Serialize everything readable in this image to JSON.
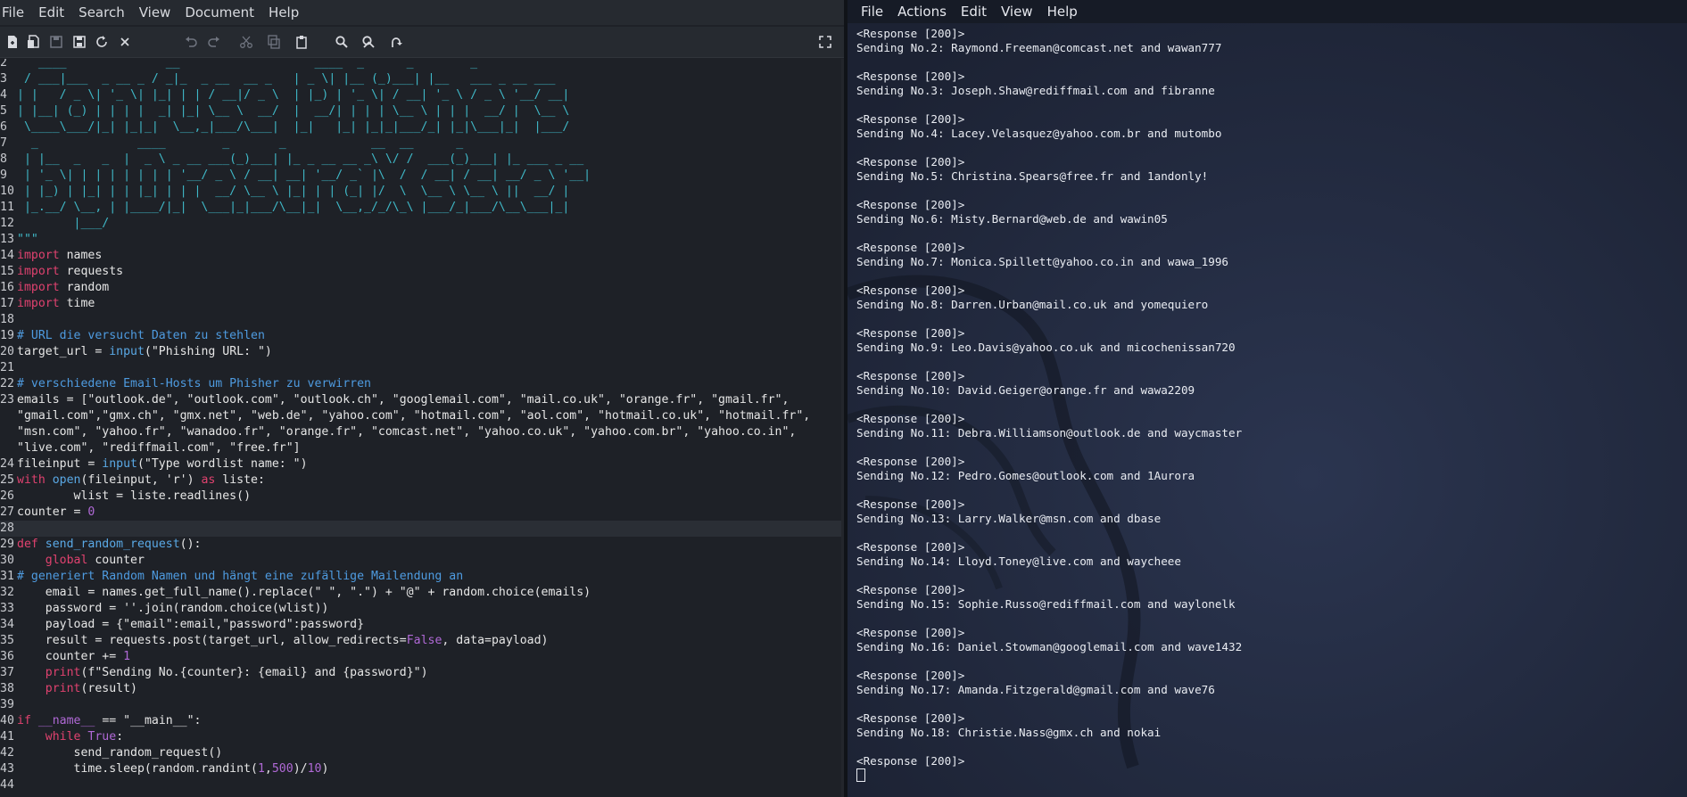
{
  "editor": {
    "menu": [
      "File",
      "Edit",
      "Search",
      "View",
      "Document",
      "Help"
    ],
    "toolbar_icons": [
      "new-file-icon",
      "new-window-icon",
      "save-icon",
      "save-as-icon",
      "reload-icon",
      "close-icon",
      "undo-icon",
      "redo-icon",
      "cut-icon",
      "copy-icon",
      "paste-icon",
      "find-icon",
      "find-replace-icon",
      "goto-icon",
      "fullscreen-icon"
    ],
    "current_line": 28,
    "lines": [
      {
        "n": "2",
        "segs": [
          [
            "art",
            "   ____              __                   ____  _      _        _        "
          ]
        ]
      },
      {
        "n": "3",
        "segs": [
          [
            "art",
            " / ___|___  _ __ _ / _|_  _ __  __ _   | _ \\| |__ (_)___| |__   ___ _ __ ___"
          ]
        ]
      },
      {
        "n": "4",
        "segs": [
          [
            "art",
            "| |   / _ \\| '_ \\| |_| | | / __|/ _ \\  | |_) | '_ \\| / __| '_ \\ / _ \\ '__/ __|"
          ]
        ]
      },
      {
        "n": "5",
        "segs": [
          [
            "art",
            "| |__| (_) | | | |  _| |_| \\__ \\  __/  |  __/| | | | \\__ \\ | | |  __/ |  \\__ \\"
          ]
        ]
      },
      {
        "n": "6",
        "segs": [
          [
            "art",
            " \\____\\___/|_| |_|_|  \\__,_|___/\\___|  |_|   |_| |_|_|___/_| |_|\\___|_|  |___/"
          ]
        ]
      },
      {
        "n": "7",
        "segs": [
          [
            "art",
            "  _              ____        _       _            __  __      _     "
          ]
        ]
      },
      {
        "n": "8",
        "segs": [
          [
            "art",
            " | |__  _   _  |  _ \\ _ __ ___(_)___| |_ _ __ __ _\\ \\/ /  ___(_)___| |_ ___ _ __"
          ]
        ]
      },
      {
        "n": "9",
        "segs": [
          [
            "art",
            " | '_ \\| | | | | | | | '__/ _ \\ / __| __| '__/ _` |\\  /  / __| / __| __/ _ \\ '__|"
          ]
        ]
      },
      {
        "n": "10",
        "segs": [
          [
            "art",
            " | |_) | |_| | | |_| | | |  __/ \\__ \\ |_| | | (_| |/  \\  \\__ \\ \\__ \\ ||  __/ |"
          ]
        ]
      },
      {
        "n": "11",
        "segs": [
          [
            "art",
            " |_.__/ \\__, | |____/|_|  \\___|_|___/\\__|_|  \\__,_/_/\\_\\ |___/_|___/\\__\\___|_|"
          ]
        ]
      },
      {
        "n": "12",
        "segs": [
          [
            "art",
            "        |___/"
          ]
        ]
      },
      {
        "n": "13",
        "segs": [
          [
            "art",
            "\"\"\""
          ]
        ]
      },
      {
        "n": "14",
        "segs": [
          [
            "kw",
            "import"
          ],
          [
            "",
            " names"
          ]
        ]
      },
      {
        "n": "15",
        "segs": [
          [
            "kw",
            "import"
          ],
          [
            "",
            " requests"
          ]
        ]
      },
      {
        "n": "16",
        "segs": [
          [
            "kw",
            "import"
          ],
          [
            "",
            " random"
          ]
        ]
      },
      {
        "n": "17",
        "segs": [
          [
            "kw",
            "import"
          ],
          [
            "",
            " time"
          ]
        ]
      },
      {
        "n": "18",
        "segs": [
          [
            "",
            ""
          ]
        ]
      },
      {
        "n": "19",
        "segs": [
          [
            "cm",
            "# URL die versucht Daten zu stehlen"
          ]
        ]
      },
      {
        "n": "20",
        "segs": [
          [
            "",
            "target_url = "
          ],
          [
            "bl",
            "input"
          ],
          [
            "",
            "(\"Phishing URL: \")"
          ]
        ]
      },
      {
        "n": "21",
        "segs": [
          [
            "",
            ""
          ]
        ]
      },
      {
        "n": "22",
        "segs": [
          [
            "cm",
            "# verschiedene Email-Hosts um Phisher zu verwirren"
          ]
        ]
      },
      {
        "n": "23",
        "segs": [
          [
            "",
            "emails = [\"outlook.de\", \"outlook.com\", \"outlook.ch\", \"googlemail.com\", \"mail.co.uk\", \"orange.fr\", \"gmail.fr\","
          ]
        ]
      },
      {
        "n": "",
        "segs": [
          [
            "",
            "\"gmail.com\",\"gmx.ch\", \"gmx.net\", \"web.de\", \"yahoo.com\", \"hotmail.com\", \"aol.com\", \"hotmail.co.uk\", \"hotmail.fr\","
          ]
        ]
      },
      {
        "n": "",
        "segs": [
          [
            "",
            "\"msn.com\", \"yahoo.fr\", \"wanadoo.fr\", \"orange.fr\", \"comcast.net\", \"yahoo.co.uk\", \"yahoo.com.br\", \"yahoo.co.in\","
          ]
        ]
      },
      {
        "n": "",
        "segs": [
          [
            "",
            "\"live.com\", \"rediffmail.com\", \"free.fr\"]"
          ]
        ]
      },
      {
        "n": "24",
        "segs": [
          [
            "",
            "fileinput = "
          ],
          [
            "bl",
            "input"
          ],
          [
            "",
            "(\"Type wordlist name: \")"
          ]
        ]
      },
      {
        "n": "25",
        "segs": [
          [
            "kw",
            "with"
          ],
          [
            "",
            " "
          ],
          [
            "bl",
            "open"
          ],
          [
            "",
            "(fileinput, 'r') "
          ],
          [
            "kw",
            "as"
          ],
          [
            "",
            " liste:"
          ]
        ]
      },
      {
        "n": "26",
        "segs": [
          [
            "",
            "        wlist = liste.readlines()"
          ]
        ]
      },
      {
        "n": "27",
        "segs": [
          [
            "",
            "counter = "
          ],
          [
            "num",
            "0"
          ]
        ]
      },
      {
        "n": "28",
        "segs": [
          [
            "",
            ""
          ]
        ]
      },
      {
        "n": "29",
        "segs": [
          [
            "kw",
            "def"
          ],
          [
            "",
            " "
          ],
          [
            "fn",
            "send_random_request"
          ],
          [
            "",
            "():"
          ]
        ]
      },
      {
        "n": "30",
        "segs": [
          [
            "",
            "    "
          ],
          [
            "kw",
            "global"
          ],
          [
            "",
            " counter"
          ]
        ]
      },
      {
        "n": "31",
        "segs": [
          [
            "cm",
            "# generiert Random Namen und hängt eine zufällige Mailendung an"
          ]
        ]
      },
      {
        "n": "32",
        "segs": [
          [
            "",
            "    email = names.get_full_name().replace(\" \", \".\") + \"@\" + random.choice(emails)"
          ]
        ]
      },
      {
        "n": "33",
        "segs": [
          [
            "",
            "    password = ''.join(random.choice(wlist))"
          ]
        ]
      },
      {
        "n": "34",
        "segs": [
          [
            "",
            "    payload = {\"email\":email,\"password\":password}"
          ]
        ]
      },
      {
        "n": "35",
        "segs": [
          [
            "",
            "    result = requests.post(target_url, allow_redirects="
          ],
          [
            "pk",
            "False"
          ],
          [
            "",
            ", data=payload)"
          ]
        ]
      },
      {
        "n": "36",
        "segs": [
          [
            "",
            "    counter += "
          ],
          [
            "num",
            "1"
          ]
        ]
      },
      {
        "n": "37",
        "segs": [
          [
            "",
            "    "
          ],
          [
            "kw",
            "print"
          ],
          [
            "",
            "(f\"Sending No.{counter}: {email} and {password}\")"
          ]
        ]
      },
      {
        "n": "38",
        "segs": [
          [
            "",
            "    "
          ],
          [
            "kw",
            "print"
          ],
          [
            "",
            "(result)"
          ]
        ]
      },
      {
        "n": "39",
        "segs": [
          [
            "",
            ""
          ]
        ]
      },
      {
        "n": "40",
        "segs": [
          [
            "kw",
            "if"
          ],
          [
            "",
            " "
          ],
          [
            "pk",
            "__name__"
          ],
          [
            "",
            " == \"__main__\":"
          ]
        ]
      },
      {
        "n": "41",
        "segs": [
          [
            "",
            "    "
          ],
          [
            "kw",
            "while"
          ],
          [
            "",
            " "
          ],
          [
            "pk",
            "True"
          ],
          [
            "",
            ":"
          ]
        ]
      },
      {
        "n": "42",
        "segs": [
          [
            "",
            "        send_random_request()"
          ]
        ]
      },
      {
        "n": "43",
        "segs": [
          [
            "",
            "        time.sleep(random.randint("
          ],
          [
            "num",
            "1"
          ],
          [
            "",
            ","
          ],
          [
            "num",
            "500"
          ],
          [
            "",
            ")/"
          ],
          [
            "num",
            "10"
          ],
          [
            "",
            ")"
          ]
        ]
      },
      {
        "n": "44",
        "segs": [
          [
            "",
            ""
          ]
        ]
      }
    ]
  },
  "terminal": {
    "menu": [
      "File",
      "Actions",
      "Edit",
      "View",
      "Help"
    ],
    "first_response": "<Response [200]>",
    "entries": [
      {
        "response": "<Response [200]>",
        "sending": "Sending No.2: Raymond.Freeman@comcast.net and wawan777"
      },
      {
        "response": "<Response [200]>",
        "sending": "Sending No.3: Joseph.Shaw@rediffmail.com and fibranne"
      },
      {
        "response": "<Response [200]>",
        "sending": "Sending No.4: Lacey.Velasquez@yahoo.com.br and mutombo"
      },
      {
        "response": "<Response [200]>",
        "sending": "Sending No.5: Christina.Spears@free.fr and 1andonly!"
      },
      {
        "response": "<Response [200]>",
        "sending": "Sending No.6: Misty.Bernard@web.de and wawin05"
      },
      {
        "response": "<Response [200]>",
        "sending": "Sending No.7: Monica.Spillett@yahoo.co.in and wawa_1996"
      },
      {
        "response": "<Response [200]>",
        "sending": "Sending No.8: Darren.Urban@mail.co.uk and yomequiero"
      },
      {
        "response": "<Response [200]>",
        "sending": "Sending No.9: Leo.Davis@yahoo.co.uk and micochenissan720"
      },
      {
        "response": "<Response [200]>",
        "sending": "Sending No.10: David.Geiger@orange.fr and wawa2209"
      },
      {
        "response": "<Response [200]>",
        "sending": "Sending No.11: Debra.Williamson@outlook.de and waycmaster"
      },
      {
        "response": "<Response [200]>",
        "sending": "Sending No.12: Pedro.Gomes@outlook.com and 1Aurora"
      },
      {
        "response": "<Response [200]>",
        "sending": "Sending No.13: Larry.Walker@msn.com and dbase"
      },
      {
        "response": "<Response [200]>",
        "sending": "Sending No.14: Lloyd.Toney@live.com and waycheee"
      },
      {
        "response": "<Response [200]>",
        "sending": "Sending No.15: Sophie.Russo@rediffmail.com and waylonelk"
      },
      {
        "response": "<Response [200]>",
        "sending": "Sending No.16: Daniel.Stowman@googlemail.com and wave1432"
      },
      {
        "response": "<Response [200]>",
        "sending": "Sending No.17: Amanda.Fitzgerald@gmail.com and wave76"
      },
      {
        "response": "<Response [200]>",
        "sending": "Sending No.18: Christie.Nass@gmx.ch and nokai"
      }
    ],
    "last_response": "<Response [200]>"
  }
}
